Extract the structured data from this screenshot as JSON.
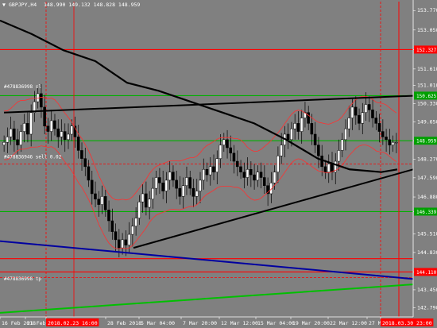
{
  "header": {
    "symbol": "GBPJPY,H4",
    "ohlc": "148.990 149.132 148.828 148.959",
    "arrow": "▼"
  },
  "colors": {
    "background": "#808080",
    "bull_candle": "#000000",
    "bear_candle": "#000000",
    "ma_thick": "#000000",
    "trendline": "#000000",
    "hline_red": "#ff0000",
    "hline_green": "#00b000",
    "blue_line": "#0000a0",
    "green_line": "#00c000",
    "envelope": "#ff3030",
    "tag_red": "#ff0000",
    "tag_green": "#00a000"
  },
  "chart_data": {
    "type": "candlestick",
    "symbol": "GBPJPY",
    "timeframe": "H4",
    "y_ticks": [
      "153.770",
      "153.050",
      "152.327",
      "151.610",
      "151.010",
      "150.330",
      "149.650",
      "148.959",
      "148.270",
      "147.590",
      "146.880",
      "146.339",
      "145.510",
      "144.830",
      "144.110",
      "143.450",
      "142.790"
    ],
    "ylim": [
      142.45,
      154.1
    ],
    "x_ticks": [
      "16 Feb 2018",
      "21 Feb",
      "2018.02.23 16:00",
      "28 Feb 2018",
      "5 Mar 04:00",
      "7 Mar 20:00",
      "12 Mar 12:00",
      "15 Mar 04:00",
      "19 Mar 20:00",
      "22 Mar 12:00",
      "27 Mar 04:00",
      "2018.03.30 23:00"
    ],
    "price_tags": [
      {
        "value": "152.327",
        "color": "red"
      },
      {
        "value": "150.625",
        "color": "green"
      },
      {
        "value": "148.959",
        "color": "green"
      },
      {
        "value": "146.339",
        "color": "green"
      },
      {
        "value": "144.110",
        "color": "red"
      }
    ],
    "horizontal_levels": [
      {
        "price": 152.327,
        "color": "red",
        "style": "solid"
      },
      {
        "price": 150.625,
        "color": "green",
        "style": "solid"
      },
      {
        "price": 148.959,
        "color": "green",
        "style": "solid"
      },
      {
        "price": 146.339,
        "color": "green",
        "style": "solid"
      },
      {
        "price": 144.6,
        "color": "red",
        "style": "solid"
      },
      {
        "price": 144.11,
        "color": "red",
        "style": "solid"
      },
      {
        "price": 148.1,
        "color": "red",
        "style": "dashed"
      },
      {
        "price": 143.9,
        "color": "red",
        "style": "dashed"
      }
    ],
    "order_labels": [
      {
        "text": "#478836998 sl",
        "price": 150.9
      },
      {
        "text": "#478836946 sell 0.02",
        "price": 148.3
      },
      {
        "text": "#478836998 tp",
        "price": 143.8
      }
    ],
    "close": [
      148.9,
      149.1,
      149.4,
      149.0,
      148.8,
      149.3,
      149.6,
      149.2,
      150.0,
      150.4,
      150.7,
      150.2,
      149.5,
      149.3,
      149.7,
      149.4,
      149.1,
      149.3,
      149.0,
      149.2,
      149.5,
      149.1,
      148.6,
      148.3,
      148.0,
      147.5,
      147.0,
      146.8,
      146.6,
      146.9,
      146.4,
      146.0,
      145.6,
      145.3,
      145.0,
      145.3,
      145.1,
      145.5,
      145.8,
      146.1,
      146.7,
      147.0,
      146.5,
      146.8,
      147.2,
      147.6,
      147.4,
      147.1,
      147.5,
      147.8,
      147.5,
      147.2,
      146.9,
      147.3,
      147.6,
      147.2,
      146.9,
      147.1,
      147.5,
      147.9,
      147.7,
      148.0,
      147.8,
      148.3,
      148.8,
      149.0,
      148.7,
      148.5,
      148.2,
      148.0,
      147.8,
      147.6,
      147.9,
      147.7,
      147.5,
      147.8,
      147.6,
      147.3,
      147.0,
      147.4,
      147.8,
      148.4,
      148.8,
      149.2,
      149.0,
      149.4,
      149.6,
      149.3,
      149.8,
      150.0,
      149.6,
      149.2,
      148.8,
      148.4,
      148.0,
      147.8,
      148.1,
      147.8,
      148.2,
      148.6,
      149.0,
      149.4,
      149.8,
      150.2,
      149.9,
      149.6,
      150.0,
      150.3,
      150.1,
      149.8,
      149.6,
      149.3,
      149.1,
      149.0,
      148.8,
      148.9,
      148.9
    ]
  }
}
